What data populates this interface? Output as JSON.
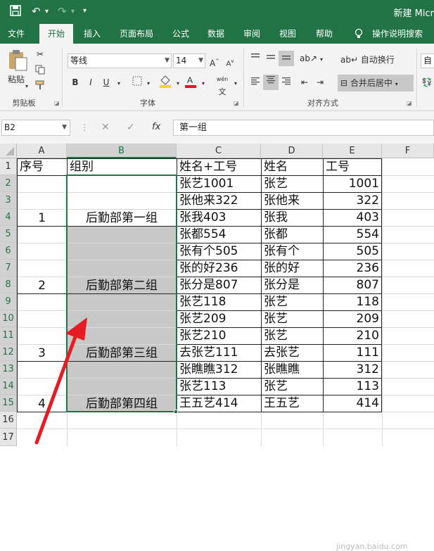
{
  "titlebar": {
    "save_icon": "save-icon",
    "undo_icon": "undo-icon",
    "redo_icon": "redo-icon",
    "customize_icon": "customize-quick-access-icon",
    "app_title": "新建 Micr"
  },
  "tabs": [
    {
      "label": "文件"
    },
    {
      "label": "开始"
    },
    {
      "label": "插入"
    },
    {
      "label": "页面布局"
    },
    {
      "label": "公式"
    },
    {
      "label": "数据"
    },
    {
      "label": "审阅"
    },
    {
      "label": "视图"
    },
    {
      "label": "帮助"
    },
    {
      "label": "操作说明搜索"
    }
  ],
  "ribbon": {
    "clipboard": {
      "paste_label": "粘贴",
      "group_label": "剪贴板"
    },
    "font": {
      "font_name": "等线",
      "font_size": "14",
      "bold": "B",
      "italic": "I",
      "underline": "U",
      "wen": "wén",
      "font_color": "#e81123",
      "fill_color": "#ffd700",
      "group_label": "字体"
    },
    "alignment": {
      "wrap_label": "自动换行",
      "merge_label": "合并后居中",
      "group_label": "对齐方式",
      "next_group_label": "自"
    }
  },
  "formula_bar": {
    "name_box": "B2",
    "cancel": "✕",
    "enter": "✓",
    "fx": "fx",
    "content": "第一组"
  },
  "columns": [
    "A",
    "B",
    "C",
    "D",
    "E",
    "F"
  ],
  "selected_column": "B",
  "rows": [
    "1",
    "2",
    "3",
    "4",
    "5",
    "6",
    "7",
    "8",
    "9",
    "10",
    "11",
    "12",
    "13",
    "14",
    "15",
    "16",
    "17"
  ],
  "header_row": {
    "a": "序号",
    "b": "组别",
    "c": "姓名+工号",
    "d": "姓名",
    "e": "工号"
  },
  "groups": [
    {
      "num": "1",
      "name": "后勤部第一组"
    },
    {
      "num": "2",
      "name": "后勤部第二组"
    },
    {
      "num": "3",
      "name": "后勤部第三组"
    },
    {
      "num": "4",
      "name": "后勤部第四组"
    }
  ],
  "records": [
    {
      "c": "张艺1001",
      "d": "张艺",
      "e": "1001"
    },
    {
      "c": "张他来322",
      "d": "张他来",
      "e": "322"
    },
    {
      "c": "张我403",
      "d": "张我",
      "e": "403"
    },
    {
      "c": "张都554",
      "d": "张都",
      "e": "554"
    },
    {
      "c": "张有个505",
      "d": "张有个",
      "e": "505"
    },
    {
      "c": "张的好236",
      "d": "张的好",
      "e": "236"
    },
    {
      "c": "张分是807",
      "d": "张分是",
      "e": "807"
    },
    {
      "c": "张艺118",
      "d": "张艺",
      "e": "118"
    },
    {
      "c": "张艺209",
      "d": "张艺",
      "e": "209"
    },
    {
      "c": "张艺210",
      "d": "张艺",
      "e": "210"
    },
    {
      "c": "去张艺111",
      "d": "去张艺",
      "e": "111"
    },
    {
      "c": "张瞧瞧312",
      "d": "张瞧瞧",
      "e": "312"
    },
    {
      "c": "张艺113",
      "d": "张艺",
      "e": "113"
    },
    {
      "c": "王五艺414",
      "d": "王五艺",
      "e": "414"
    }
  ],
  "colors": {
    "excel_green": "#217346",
    "selection_fill": "#c8c8c8",
    "arrow": "#e51c23"
  },
  "watermark": "jingyan.baidu.com"
}
